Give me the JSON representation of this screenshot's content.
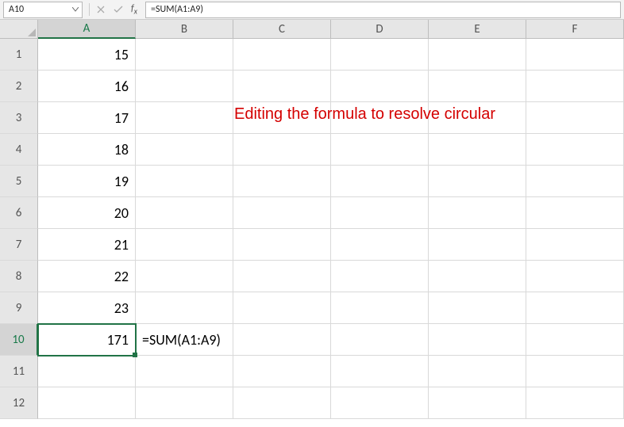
{
  "formula_bar": {
    "name_box": "A10",
    "formula": "=SUM(A1:A9)"
  },
  "columns": [
    "A",
    "B",
    "C",
    "D",
    "E",
    "F"
  ],
  "rows": [
    1,
    2,
    3,
    4,
    5,
    6,
    7,
    8,
    9,
    10,
    11,
    12
  ],
  "active_col_index": 0,
  "active_row_index": 9,
  "cells": {
    "A1": "15",
    "A2": "16",
    "A3": "17",
    "A4": "18",
    "A5": "19",
    "A6": "20",
    "A7": "21",
    "A8": "22",
    "A9": "23",
    "A10": "171",
    "B10": "=SUM(A1:A9)"
  },
  "chart_data": {
    "type": "table",
    "columns": [
      "A"
    ],
    "values": [
      15,
      16,
      17,
      18,
      19,
      20,
      21,
      22,
      23
    ],
    "sum": 171,
    "formula": "=SUM(A1:A9)"
  },
  "annotation": {
    "text": "Editing the formula to resolve circular",
    "color": "#d40000"
  }
}
